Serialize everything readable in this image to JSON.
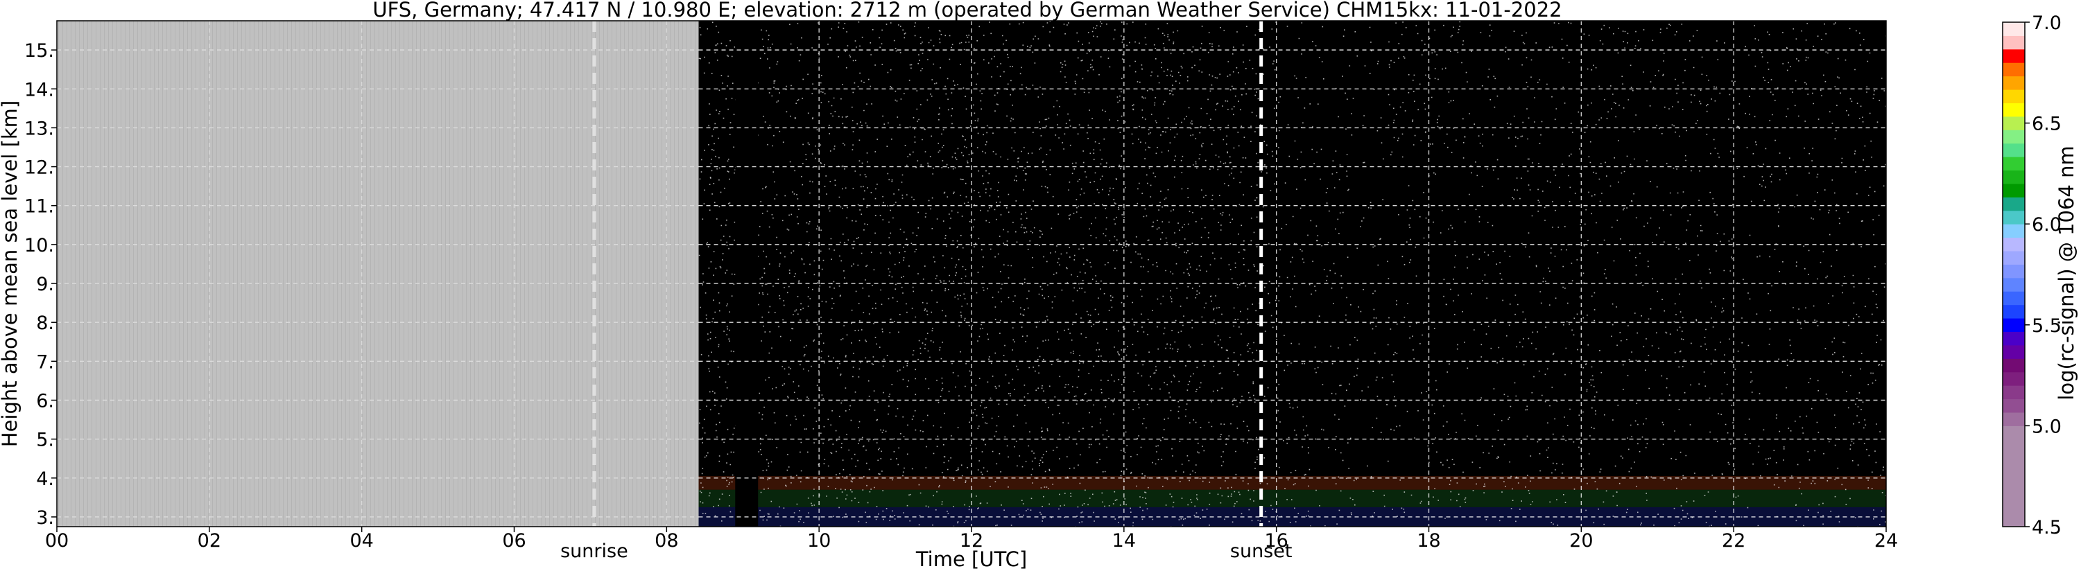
{
  "chart_data": {
    "type": "heatmap",
    "title": "UFS, Germany; 47.417 N / 10.980 E; elevation: 2712 m  (operated by German Weather Service)    CHM15kx: 11-01-2022",
    "xlabel": "Time [UTC]",
    "ylabel": "Height above mean sea level [km]",
    "xlim": [
      0,
      24
    ],
    "ylim": [
      2.75,
      15.75
    ],
    "x_ticks": [
      "00",
      "02",
      "04",
      "06",
      "08",
      "10",
      "12",
      "14",
      "16",
      "18",
      "20",
      "22",
      "24"
    ],
    "x_tick_values": [
      0,
      2,
      4,
      6,
      8,
      10,
      12,
      14,
      16,
      18,
      20,
      22,
      24
    ],
    "y_ticks": [
      "3.",
      "4.",
      "5.",
      "6.",
      "7.",
      "8.",
      "9.",
      "10.",
      "11.",
      "12.",
      "13.",
      "14.",
      "15."
    ],
    "y_tick_values": [
      3,
      4,
      5,
      6,
      7,
      8,
      9,
      10,
      11,
      12,
      13,
      14,
      15
    ],
    "grid": true,
    "no_data_period": [
      0.0,
      8.42
    ],
    "no_data_color": "#c0c0c0",
    "background_color": "#000000",
    "data_gap": [
      8.9,
      9.2
    ],
    "events": [
      {
        "label": "sunrise",
        "time": 7.05,
        "line_color": "#e0e0e0"
      },
      {
        "label": "sunset",
        "time": 15.8,
        "line_color": "#ffffff"
      }
    ],
    "colorbar": {
      "label": "log(rc-signal) @ 1064 nm",
      "range": [
        4.5,
        7.0
      ],
      "ticks": [
        "4.5",
        "5.0",
        "5.5",
        "6.0",
        "6.5",
        "7.0"
      ],
      "tick_values": [
        4.5,
        5.0,
        5.5,
        6.0,
        6.5,
        7.0
      ],
      "colors": [
        "#ab8bab",
        "#9f6e9f",
        "#924e92",
        "#8a3a8a",
        "#7e1f7e",
        "#730b73",
        "#6400a6",
        "#4b00c8",
        "#0000ff",
        "#1c44ff",
        "#3a66ff",
        "#5f84ff",
        "#8095ff",
        "#9ea8ff",
        "#b8b8ff",
        "#86ceff",
        "#4bc8c8",
        "#19a889",
        "#009a00",
        "#19b419",
        "#32cd32",
        "#54e08a",
        "#84f084",
        "#b8f050",
        "#ffff00",
        "#ffd700",
        "#ffa500",
        "#ff6e00",
        "#ff0000",
        "#ffc0c0",
        "#ffe8e8"
      ]
    },
    "signal_layers": [
      {
        "height_from": 2.75,
        "height_to": 3.25,
        "color": "#2233cc"
      },
      {
        "height_from": 3.25,
        "height_to": 3.7,
        "color": "#1e8a2a"
      },
      {
        "height_from": 3.7,
        "height_to": 4.05,
        "color": "#cc4411"
      }
    ]
  }
}
